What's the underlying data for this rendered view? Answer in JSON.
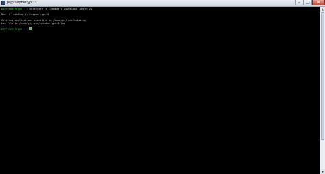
{
  "window": {
    "title": "pi@raspberrypi: ~",
    "minimize": "–",
    "maximize": "□",
    "close": "✕"
  },
  "terminal": {
    "line1_prompt": "pi@raspberrypi",
    "line1_path": "~ $",
    "line1_cmd": " vncserver :0 -geometry 1920x1080 -depth 24",
    "line2": "New 'X' desktop is raspberrypi:0",
    "line3": "Starting applications specified in /home/pi/.vnc/xstartup",
    "line4": "Log file is /home/pi/.vnc/raspberrypi:0.log",
    "line5_prompt": "pi@raspberrypi",
    "line5_path": "~ $"
  },
  "scrollbar": {
    "up": "▲",
    "down": "▼"
  }
}
